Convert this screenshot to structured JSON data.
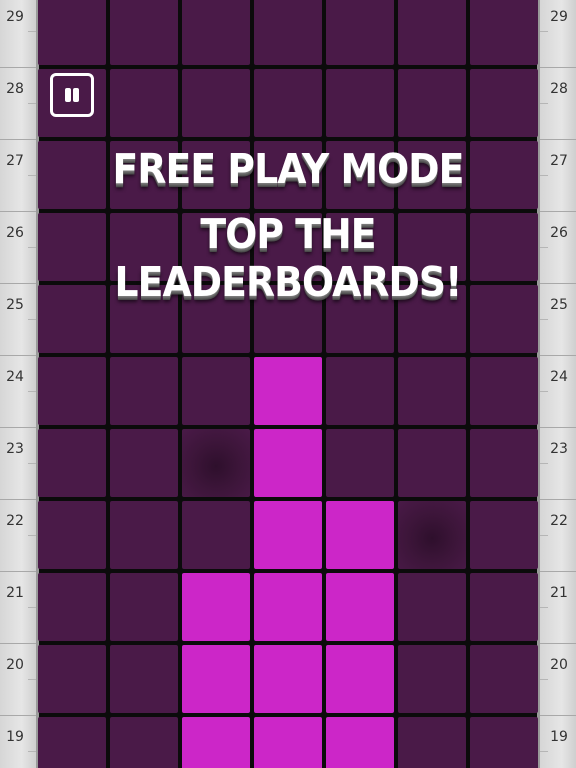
{
  "game": {
    "banner_line1": "FREE PLAY MODE",
    "banner_line2": "TOP THE LEADERBOARDS!",
    "pause_label": "Pause",
    "colors": {
      "empty_tile": "#4a1a48",
      "lit_tile": "#cc26c8",
      "grid_gap": "#0b0b0b",
      "ruler": "#dddddd"
    }
  },
  "ruler": {
    "left_numbers": [
      "29",
      "28",
      "27",
      "26",
      "25",
      "24",
      "23",
      "22",
      "21",
      "20",
      "19"
    ],
    "right_numbers": [
      "29",
      "28",
      "27",
      "26",
      "25",
      "24",
      "23",
      "22",
      "21",
      "20",
      "19"
    ]
  },
  "board": {
    "columns": 7,
    "rows": [
      {
        "row": 29,
        "cells": [
          "empty",
          "empty",
          "empty",
          "empty",
          "empty",
          "empty",
          "empty"
        ]
      },
      {
        "row": 28,
        "cells": [
          "empty",
          "empty",
          "empty",
          "empty",
          "empty",
          "empty",
          "empty"
        ]
      },
      {
        "row": 27,
        "cells": [
          "empty",
          "empty",
          "empty",
          "empty",
          "empty",
          "empty",
          "empty"
        ]
      },
      {
        "row": 26,
        "cells": [
          "empty",
          "empty",
          "empty",
          "empty",
          "empty",
          "empty",
          "empty"
        ]
      },
      {
        "row": 25,
        "cells": [
          "empty",
          "empty",
          "empty",
          "empty",
          "empty",
          "empty",
          "empty"
        ]
      },
      {
        "row": 24,
        "cells": [
          "empty",
          "empty",
          "empty",
          "lit",
          "empty",
          "empty",
          "empty"
        ]
      },
      {
        "row": 23,
        "cells": [
          "empty",
          "empty",
          "pressed",
          "lit",
          "empty",
          "empty",
          "empty"
        ]
      },
      {
        "row": 22,
        "cells": [
          "empty",
          "empty",
          "empty",
          "lit",
          "lit",
          "pressed",
          "empty"
        ]
      },
      {
        "row": 21,
        "cells": [
          "empty",
          "empty",
          "lit",
          "lit",
          "lit",
          "empty",
          "empty"
        ]
      },
      {
        "row": 20,
        "cells": [
          "empty",
          "empty",
          "lit",
          "lit",
          "lit",
          "empty",
          "empty"
        ]
      },
      {
        "row": 19,
        "cells": [
          "empty",
          "empty",
          "lit",
          "lit",
          "lit",
          "empty",
          "empty"
        ]
      }
    ]
  }
}
